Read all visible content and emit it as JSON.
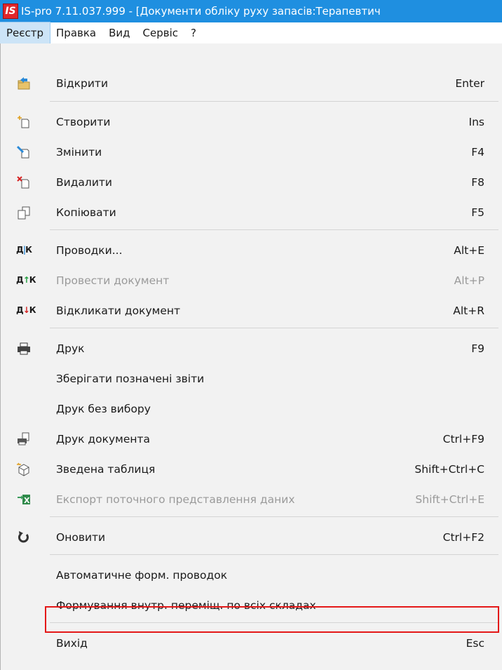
{
  "window": {
    "logo": "IS",
    "title": "IS-pro 7.11.037.999 - [Документи обліку руху запасів:Терапевтич"
  },
  "menubar": {
    "items": [
      {
        "label": "Реєстр"
      },
      {
        "label": "Правка"
      },
      {
        "label": "Вид"
      },
      {
        "label": "Сервіс"
      },
      {
        "label": "?"
      }
    ]
  },
  "menu": {
    "items": [
      {
        "label": "Відкрити",
        "shortcut": "Enter",
        "icon": "open-icon"
      },
      {
        "label": "Створити",
        "shortcut": "Ins",
        "icon": "create-icon"
      },
      {
        "label": "Змінити",
        "shortcut": "F4",
        "icon": "edit-icon"
      },
      {
        "label": "Видалити",
        "shortcut": "F8",
        "icon": "delete-icon"
      },
      {
        "label": "Копіювати",
        "shortcut": "F5",
        "icon": "copy-icon"
      },
      {
        "label": "Проводки...",
        "shortcut": "Alt+E",
        "icon": "postings-icon"
      },
      {
        "label": "Провести документ",
        "shortcut": "Alt+P",
        "icon": "post-document-icon",
        "disabled": true
      },
      {
        "label": "Відкликати документ",
        "shortcut": "Alt+R",
        "icon": "revoke-document-icon"
      },
      {
        "label": "Друк",
        "shortcut": "F9",
        "icon": "printer-icon"
      },
      {
        "label": "Зберігати позначені звіти",
        "shortcut": ""
      },
      {
        "label": "Друк без вибору",
        "shortcut": ""
      },
      {
        "label": "Друк документа",
        "shortcut": "Ctrl+F9",
        "icon": "print-document-icon"
      },
      {
        "label": "Зведена таблиця",
        "shortcut": "Shift+Ctrl+C",
        "icon": "pivot-table-icon"
      },
      {
        "label": "Експорт поточного представлення даних",
        "shortcut": "Shift+Ctrl+E",
        "icon": "excel-export-icon",
        "disabled": true
      },
      {
        "label": "Оновити",
        "shortcut": "Ctrl+F2",
        "icon": "refresh-icon"
      },
      {
        "label": "Автоматичне форм. проводок",
        "shortcut": ""
      },
      {
        "label": "Формування внутр. переміщ. по всіх складах",
        "shortcut": "",
        "highlighted": true
      },
      {
        "label": "Вихід",
        "shortcut": "Esc"
      }
    ]
  },
  "colors": {
    "titlebar": "#1f8fe0",
    "active_menu": "#cce4f7",
    "highlight_box": "#e41818"
  }
}
